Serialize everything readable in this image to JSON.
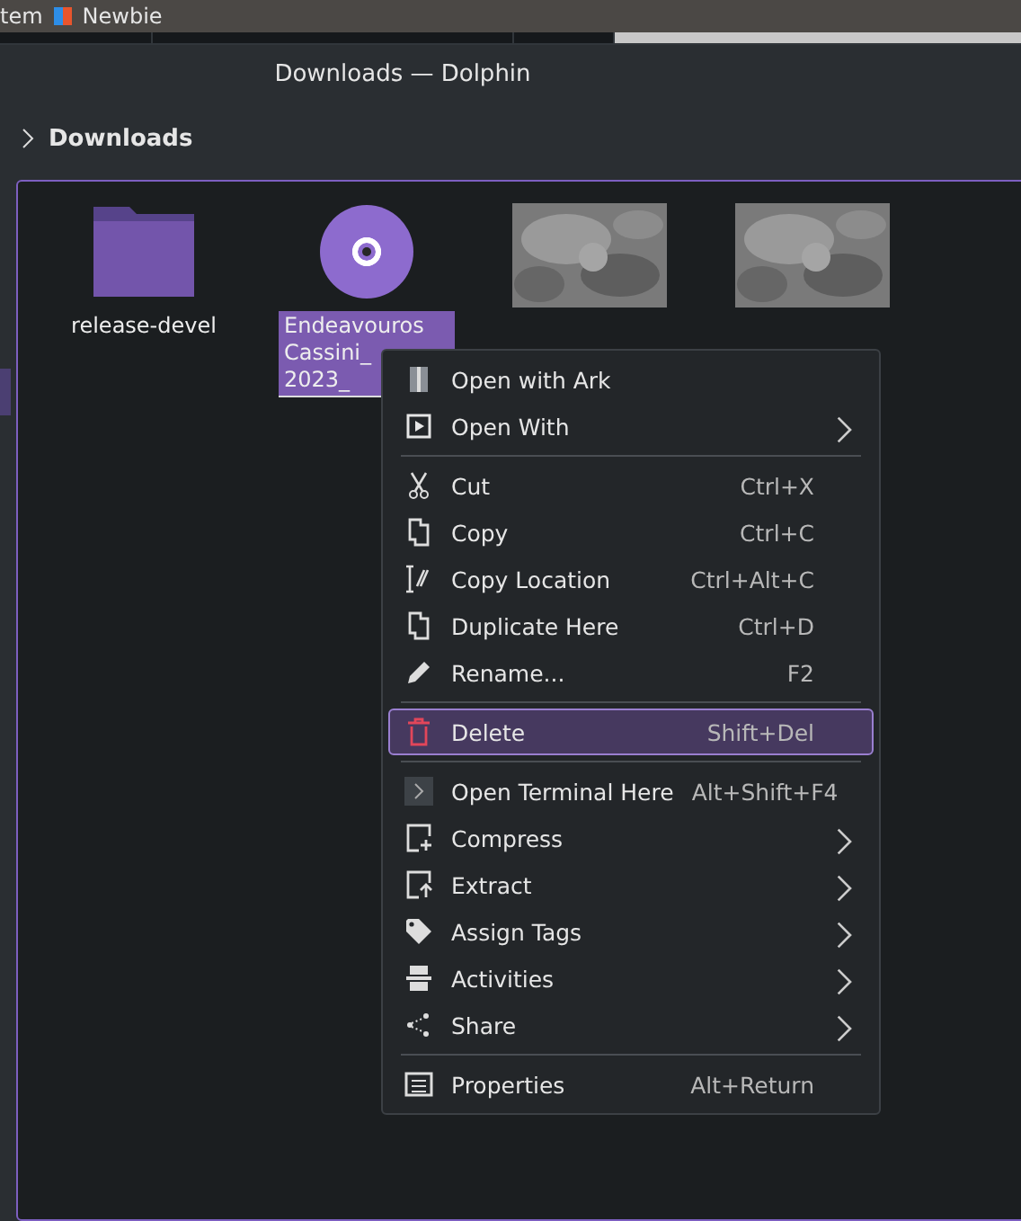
{
  "top_panel": {
    "items": [
      {
        "label": "tem"
      },
      {
        "label": "Newbie"
      }
    ]
  },
  "window": {
    "title": "Downloads — Dolphin"
  },
  "breadcrumb": {
    "label": "Downloads"
  },
  "files": [
    {
      "name_lines": [
        "release-devel"
      ],
      "kind": "folder",
      "selected": false
    },
    {
      "name_lines": [
        "Endeavouros",
        "Cassini_",
        "2023_"
      ],
      "kind": "disc",
      "selected": true
    },
    {
      "kind": "picture",
      "selected": false
    },
    {
      "kind": "picture",
      "selected": false
    }
  ],
  "context_menu": {
    "items": [
      {
        "kind": "item",
        "label": "Open with Ark",
        "selected": false,
        "submenu": false
      },
      {
        "kind": "item",
        "label": "Open With",
        "selected": false,
        "submenu": true
      },
      {
        "kind": "separator"
      },
      {
        "kind": "item",
        "label": "Cut",
        "shortcut": "Ctrl+X",
        "selected": false,
        "submenu": false
      },
      {
        "kind": "item",
        "label": "Copy",
        "shortcut": "Ctrl+C",
        "selected": false,
        "submenu": false
      },
      {
        "kind": "item",
        "label": "Copy Location",
        "shortcut": "Ctrl+Alt+C",
        "selected": false,
        "submenu": false
      },
      {
        "kind": "item",
        "label": "Duplicate Here",
        "shortcut": "Ctrl+D",
        "selected": false,
        "submenu": false
      },
      {
        "kind": "item",
        "label": "Rename...",
        "shortcut": "F2",
        "selected": false,
        "submenu": false
      },
      {
        "kind": "separator"
      },
      {
        "kind": "item",
        "label": "Delete",
        "shortcut": "Shift+Del",
        "selected": true,
        "submenu": false
      },
      {
        "kind": "separator"
      },
      {
        "kind": "item",
        "label": "Open Terminal Here",
        "shortcut": "Alt+Shift+F4",
        "selected": false,
        "submenu": false
      },
      {
        "kind": "item",
        "label": "Compress",
        "selected": false,
        "submenu": true
      },
      {
        "kind": "item",
        "label": "Extract",
        "selected": false,
        "submenu": true
      },
      {
        "kind": "item",
        "label": "Assign Tags",
        "selected": false,
        "submenu": true
      },
      {
        "kind": "item",
        "label": "Activities",
        "selected": false,
        "submenu": true
      },
      {
        "kind": "item",
        "label": "Share",
        "selected": false,
        "submenu": true
      },
      {
        "kind": "separator"
      },
      {
        "kind": "item",
        "label": "Properties",
        "shortcut": "Alt+Return",
        "selected": false,
        "submenu": false
      }
    ]
  }
}
